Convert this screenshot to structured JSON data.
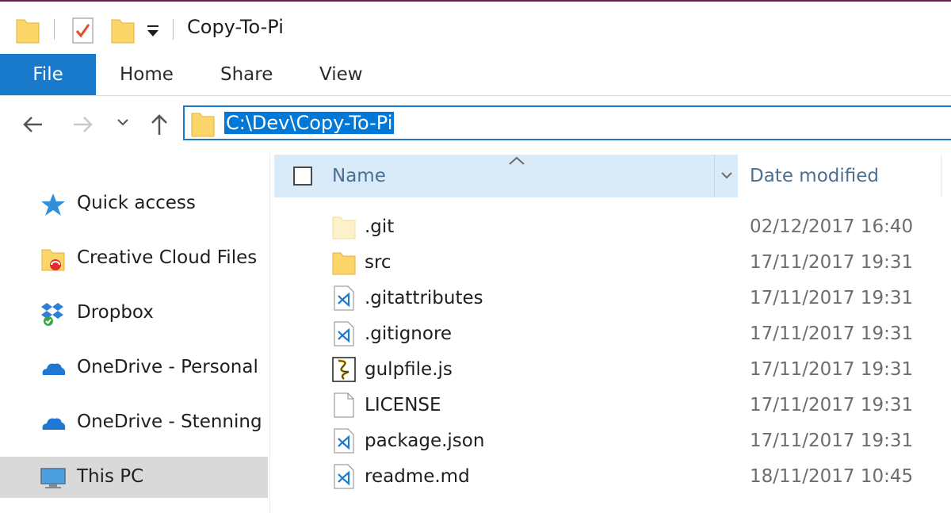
{
  "window": {
    "title": "Copy-To-Pi"
  },
  "ribbon": {
    "tabs": [
      {
        "label": "File",
        "active": true
      },
      {
        "label": "Home"
      },
      {
        "label": "Share"
      },
      {
        "label": "View"
      }
    ]
  },
  "navigation": {
    "address": "C:\\Dev\\Copy-To-Pi"
  },
  "sidebar": {
    "items": [
      {
        "label": "Quick access",
        "icon": "star-icon"
      },
      {
        "label": "Creative Cloud Files",
        "icon": "creative-cloud-folder-icon"
      },
      {
        "label": "Dropbox",
        "icon": "dropbox-icon"
      },
      {
        "label": "OneDrive - Personal",
        "icon": "onedrive-cloud-icon"
      },
      {
        "label": "OneDrive - Stenning",
        "icon": "onedrive-cloud-icon"
      },
      {
        "label": "This PC",
        "icon": "computer-monitor-icon",
        "selected": true
      }
    ]
  },
  "filelist": {
    "columns": {
      "name": "Name",
      "date": "Date modified"
    },
    "files": [
      {
        "name": ".git",
        "date": "02/12/2017 16:40",
        "icon": "hidden-folder-icon"
      },
      {
        "name": "src",
        "date": "17/11/2017 19:31",
        "icon": "folder-icon"
      },
      {
        "name": ".gitattributes",
        "date": "17/11/2017 19:31",
        "icon": "vscode-file-icon"
      },
      {
        "name": ".gitignore",
        "date": "17/11/2017 19:31",
        "icon": "vscode-file-icon"
      },
      {
        "name": "gulpfile.js",
        "date": "17/11/2017 19:31",
        "icon": "script-file-icon"
      },
      {
        "name": "LICENSE",
        "date": "17/11/2017 19:31",
        "icon": "blank-file-icon"
      },
      {
        "name": "package.json",
        "date": "17/11/2017 19:31",
        "icon": "vscode-file-icon"
      },
      {
        "name": "readme.md",
        "date": "18/11/2017 10:45",
        "icon": "vscode-file-icon"
      }
    ]
  },
  "colors": {
    "accent": "#1979ca",
    "selection": "#0078d7",
    "header_bg": "#d9ebf9",
    "sidebar_selected": "#d9d9d9",
    "folder": "#fcd669"
  }
}
